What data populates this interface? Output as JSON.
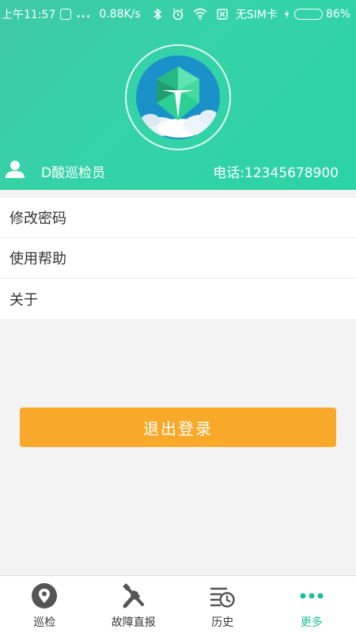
{
  "status_bar": {
    "time": "上午11:57",
    "dots": "...",
    "network_speed": "0.88K/s",
    "sim_status": "无SIM卡",
    "battery_percent": "86%",
    "battery_level": 0.86
  },
  "profile": {
    "user_name": "D酸巡检员",
    "phone": "电话:12345678900"
  },
  "menu": {
    "items": [
      {
        "label": "修改密码"
      },
      {
        "label": "使用帮助"
      },
      {
        "label": "关于"
      }
    ]
  },
  "logout": {
    "label": "退出登录"
  },
  "bottom_nav": {
    "items": [
      {
        "label": "巡检",
        "icon": "location-pin-icon"
      },
      {
        "label": "故障直报",
        "icon": "tools-icon"
      },
      {
        "label": "历史",
        "icon": "history-icon"
      },
      {
        "label": "更多",
        "icon": "more-dots-icon"
      }
    ],
    "active_index": 3
  },
  "colors": {
    "header": "#35d3a7",
    "logout": "#f8a92a",
    "active_nav": "#1fbf9c"
  }
}
